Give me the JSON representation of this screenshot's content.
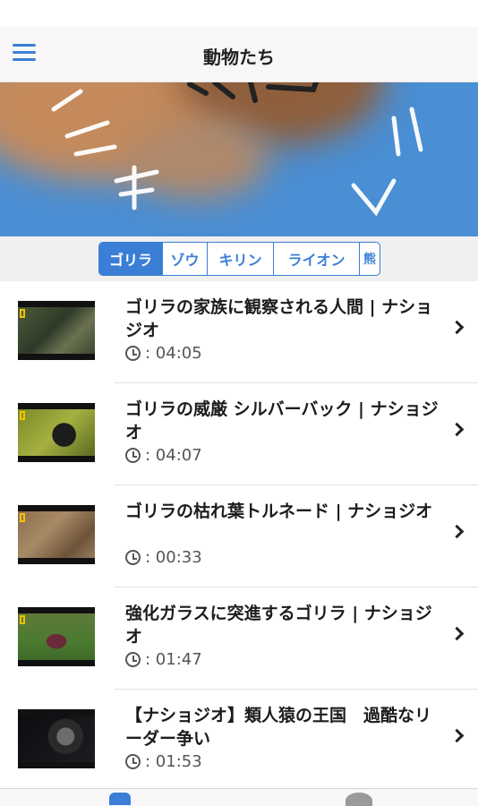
{
  "nav": {
    "title": "動物たち",
    "menu_icon": "hamburger-menu-icon"
  },
  "hero": {
    "description_icon": "gorilla-banner-image"
  },
  "segments": [
    {
      "label": "ゴリラ",
      "active": true
    },
    {
      "label": "ゾウ",
      "active": false
    },
    {
      "label": "キリン",
      "active": false
    },
    {
      "label": "ライオン",
      "active": false
    },
    {
      "label": "熊",
      "active": false
    }
  ],
  "videos": [
    {
      "title": "ゴリラの家族に観察される人間 | ナショジオ",
      "duration": ": 04:05"
    },
    {
      "title": "ゴリラの威厳 シルバーバック | ナショジオ",
      "duration": ": 04:07"
    },
    {
      "title": "ゴリラの枯れ葉トルネード | ナショジオ",
      "duration": ": 00:33"
    },
    {
      "title": "強化ガラスに突進するゴリラ | ナショジオ",
      "duration": ": 01:47"
    },
    {
      "title": "【ナショジオ】類人猿の王国　過酷なリーダー争い",
      "duration": ": 01:53"
    }
  ],
  "colors": {
    "accent": "#3a7fd5",
    "hero_bg": "#4a8ed3"
  }
}
